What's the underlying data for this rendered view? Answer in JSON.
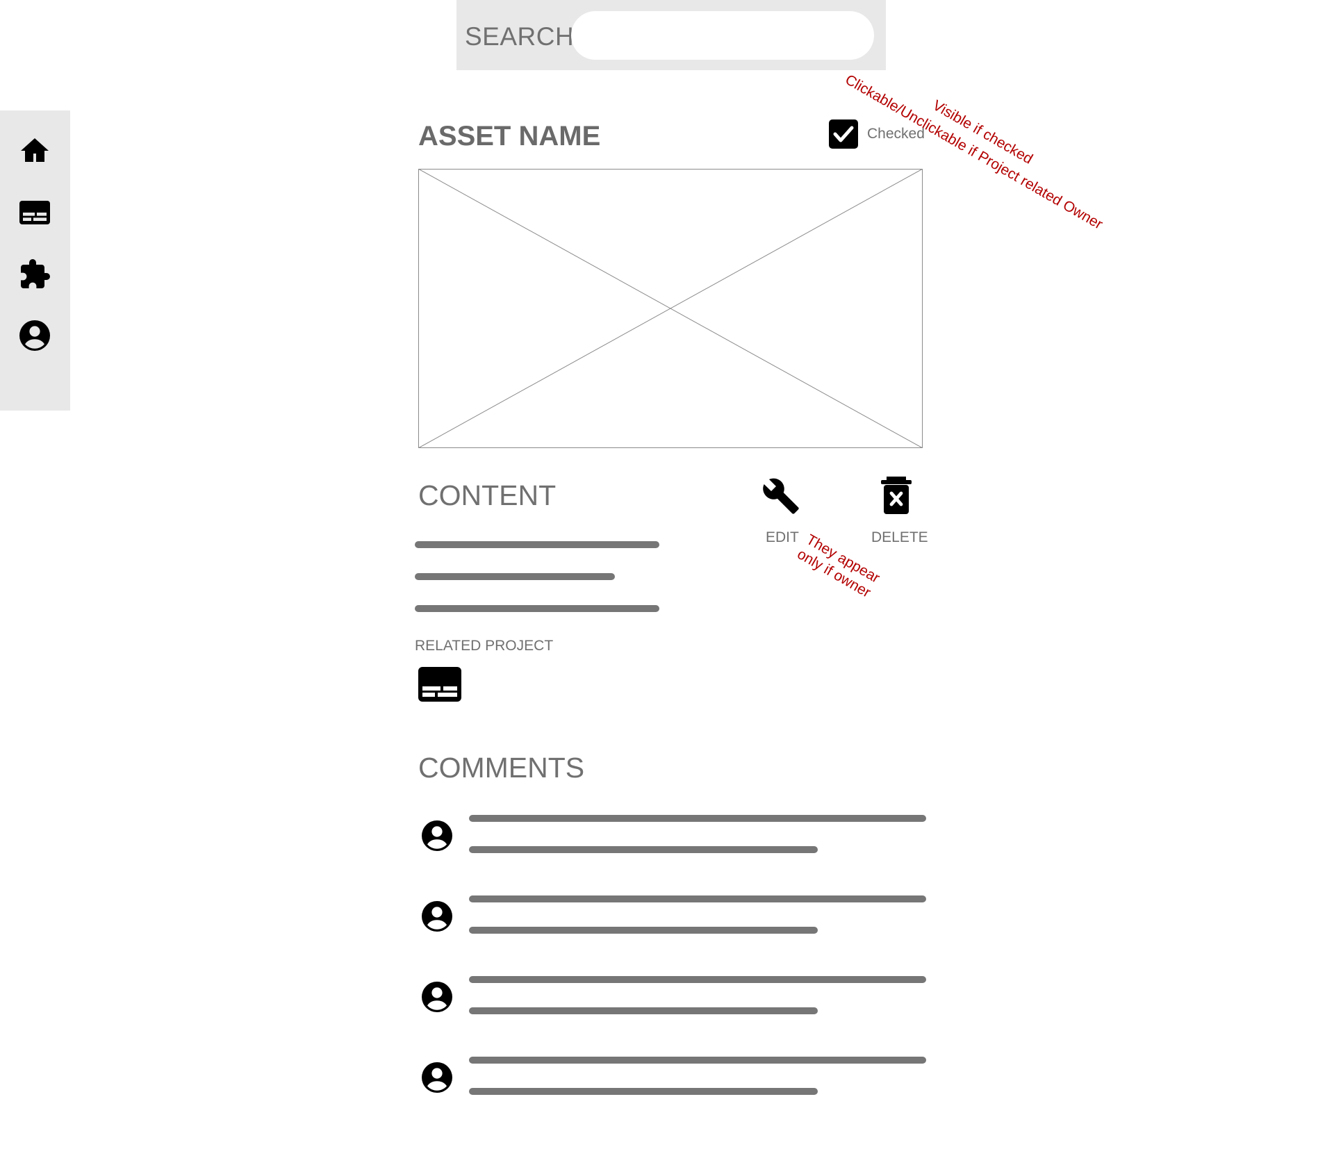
{
  "search": {
    "label": "SEARCH",
    "value": "",
    "placeholder": ""
  },
  "sidebar": {
    "items": [
      {
        "icon": "home-icon"
      },
      {
        "icon": "project-icon"
      },
      {
        "icon": "puzzle-icon"
      },
      {
        "icon": "account-icon"
      }
    ]
  },
  "asset": {
    "name": "ASSET NAME",
    "checked": true,
    "checked_label": "Checked"
  },
  "annotations": {
    "visible_if_checked": "Visible if checked",
    "clickable_note": "Clickable/Unclickable if Project related Owner",
    "appear_line1": "They appear",
    "appear_line2": "only if owner"
  },
  "content": {
    "heading": "CONTENT",
    "edit_label": "EDIT",
    "delete_label": "DELETE",
    "related_project_label": "RELATED PROJECT"
  },
  "comments": {
    "heading": "COMMENTS",
    "count": 4
  },
  "colors": {
    "panel_bg": "#e8e8e8",
    "text_gray": "#707070",
    "placeholder_bar": "#767676",
    "annotation_red": "#b30000"
  }
}
